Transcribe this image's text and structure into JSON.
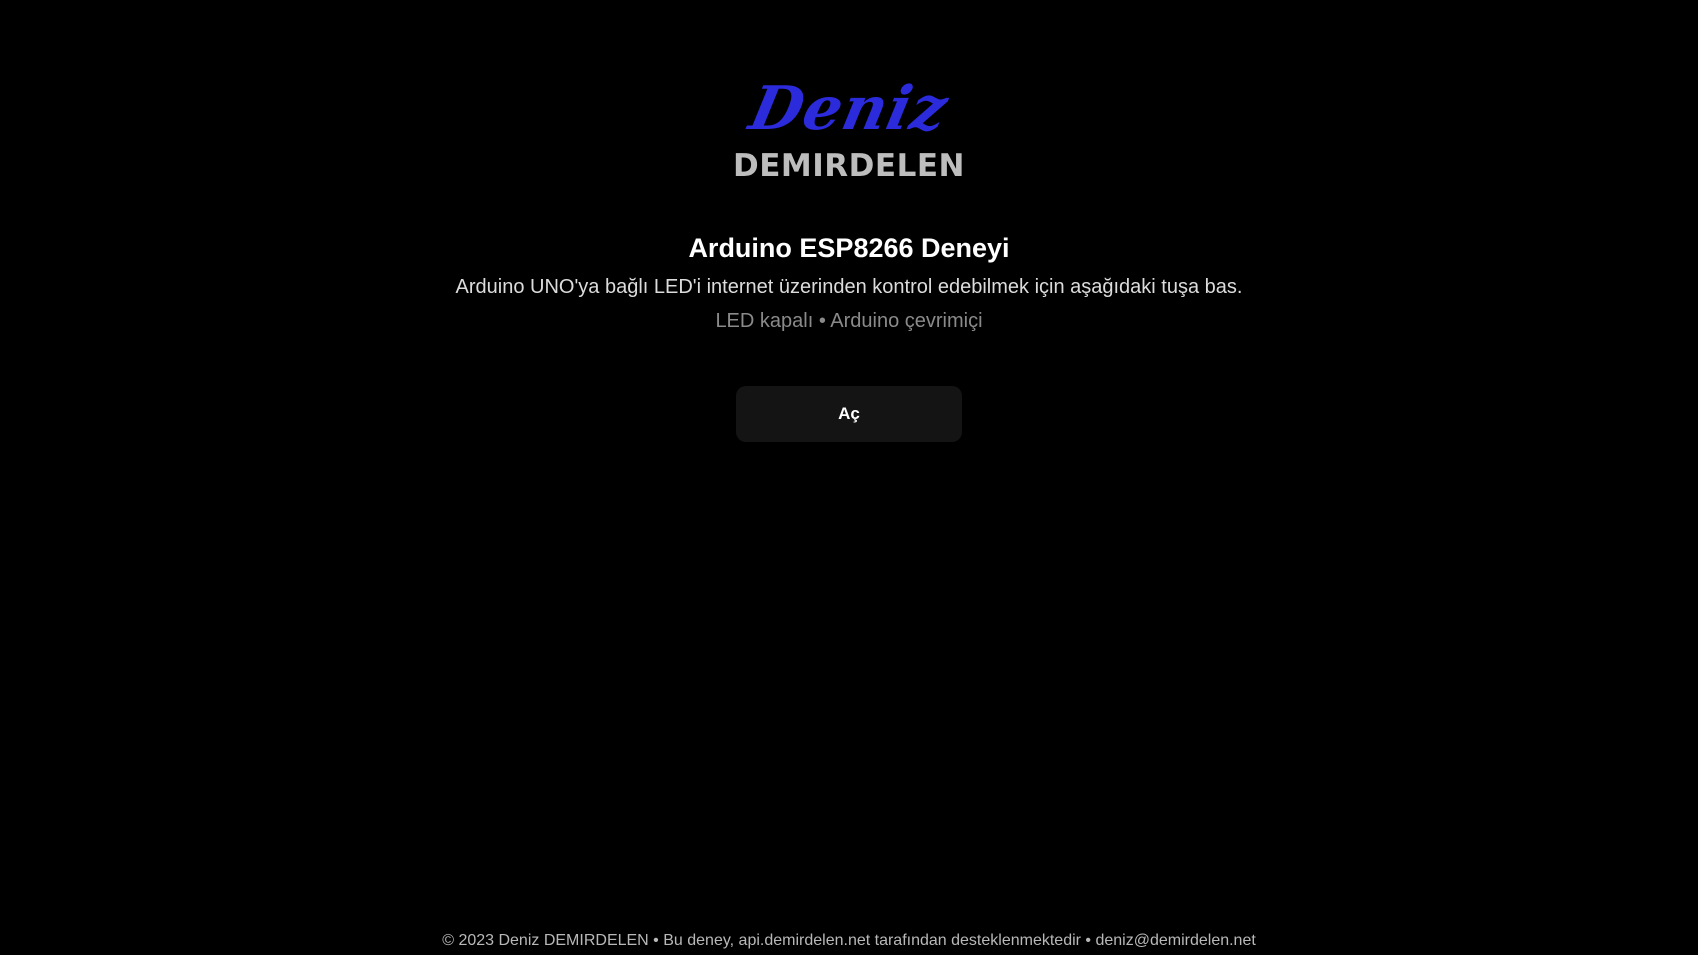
{
  "logo": {
    "script_text": "Deniz",
    "block_text": "DEMIRDELEN",
    "script_color": "#2b2bdc",
    "block_color": "#bdbdbd"
  },
  "main": {
    "title": "Arduino ESP8266 Deneyi",
    "description": "Arduino UNO'ya bağlı LED'i internet üzerinden kontrol edebilmek için aşağıdaki tuşa bas.",
    "status": "LED kapalı • Arduino çevrimiçi",
    "button_label": "Aç"
  },
  "footer": {
    "text": "© 2023 Deniz DEMIRDELEN • Bu deney, api.demirdelen.net tarafından desteklenmektedir • deniz@demirdelen.net"
  }
}
